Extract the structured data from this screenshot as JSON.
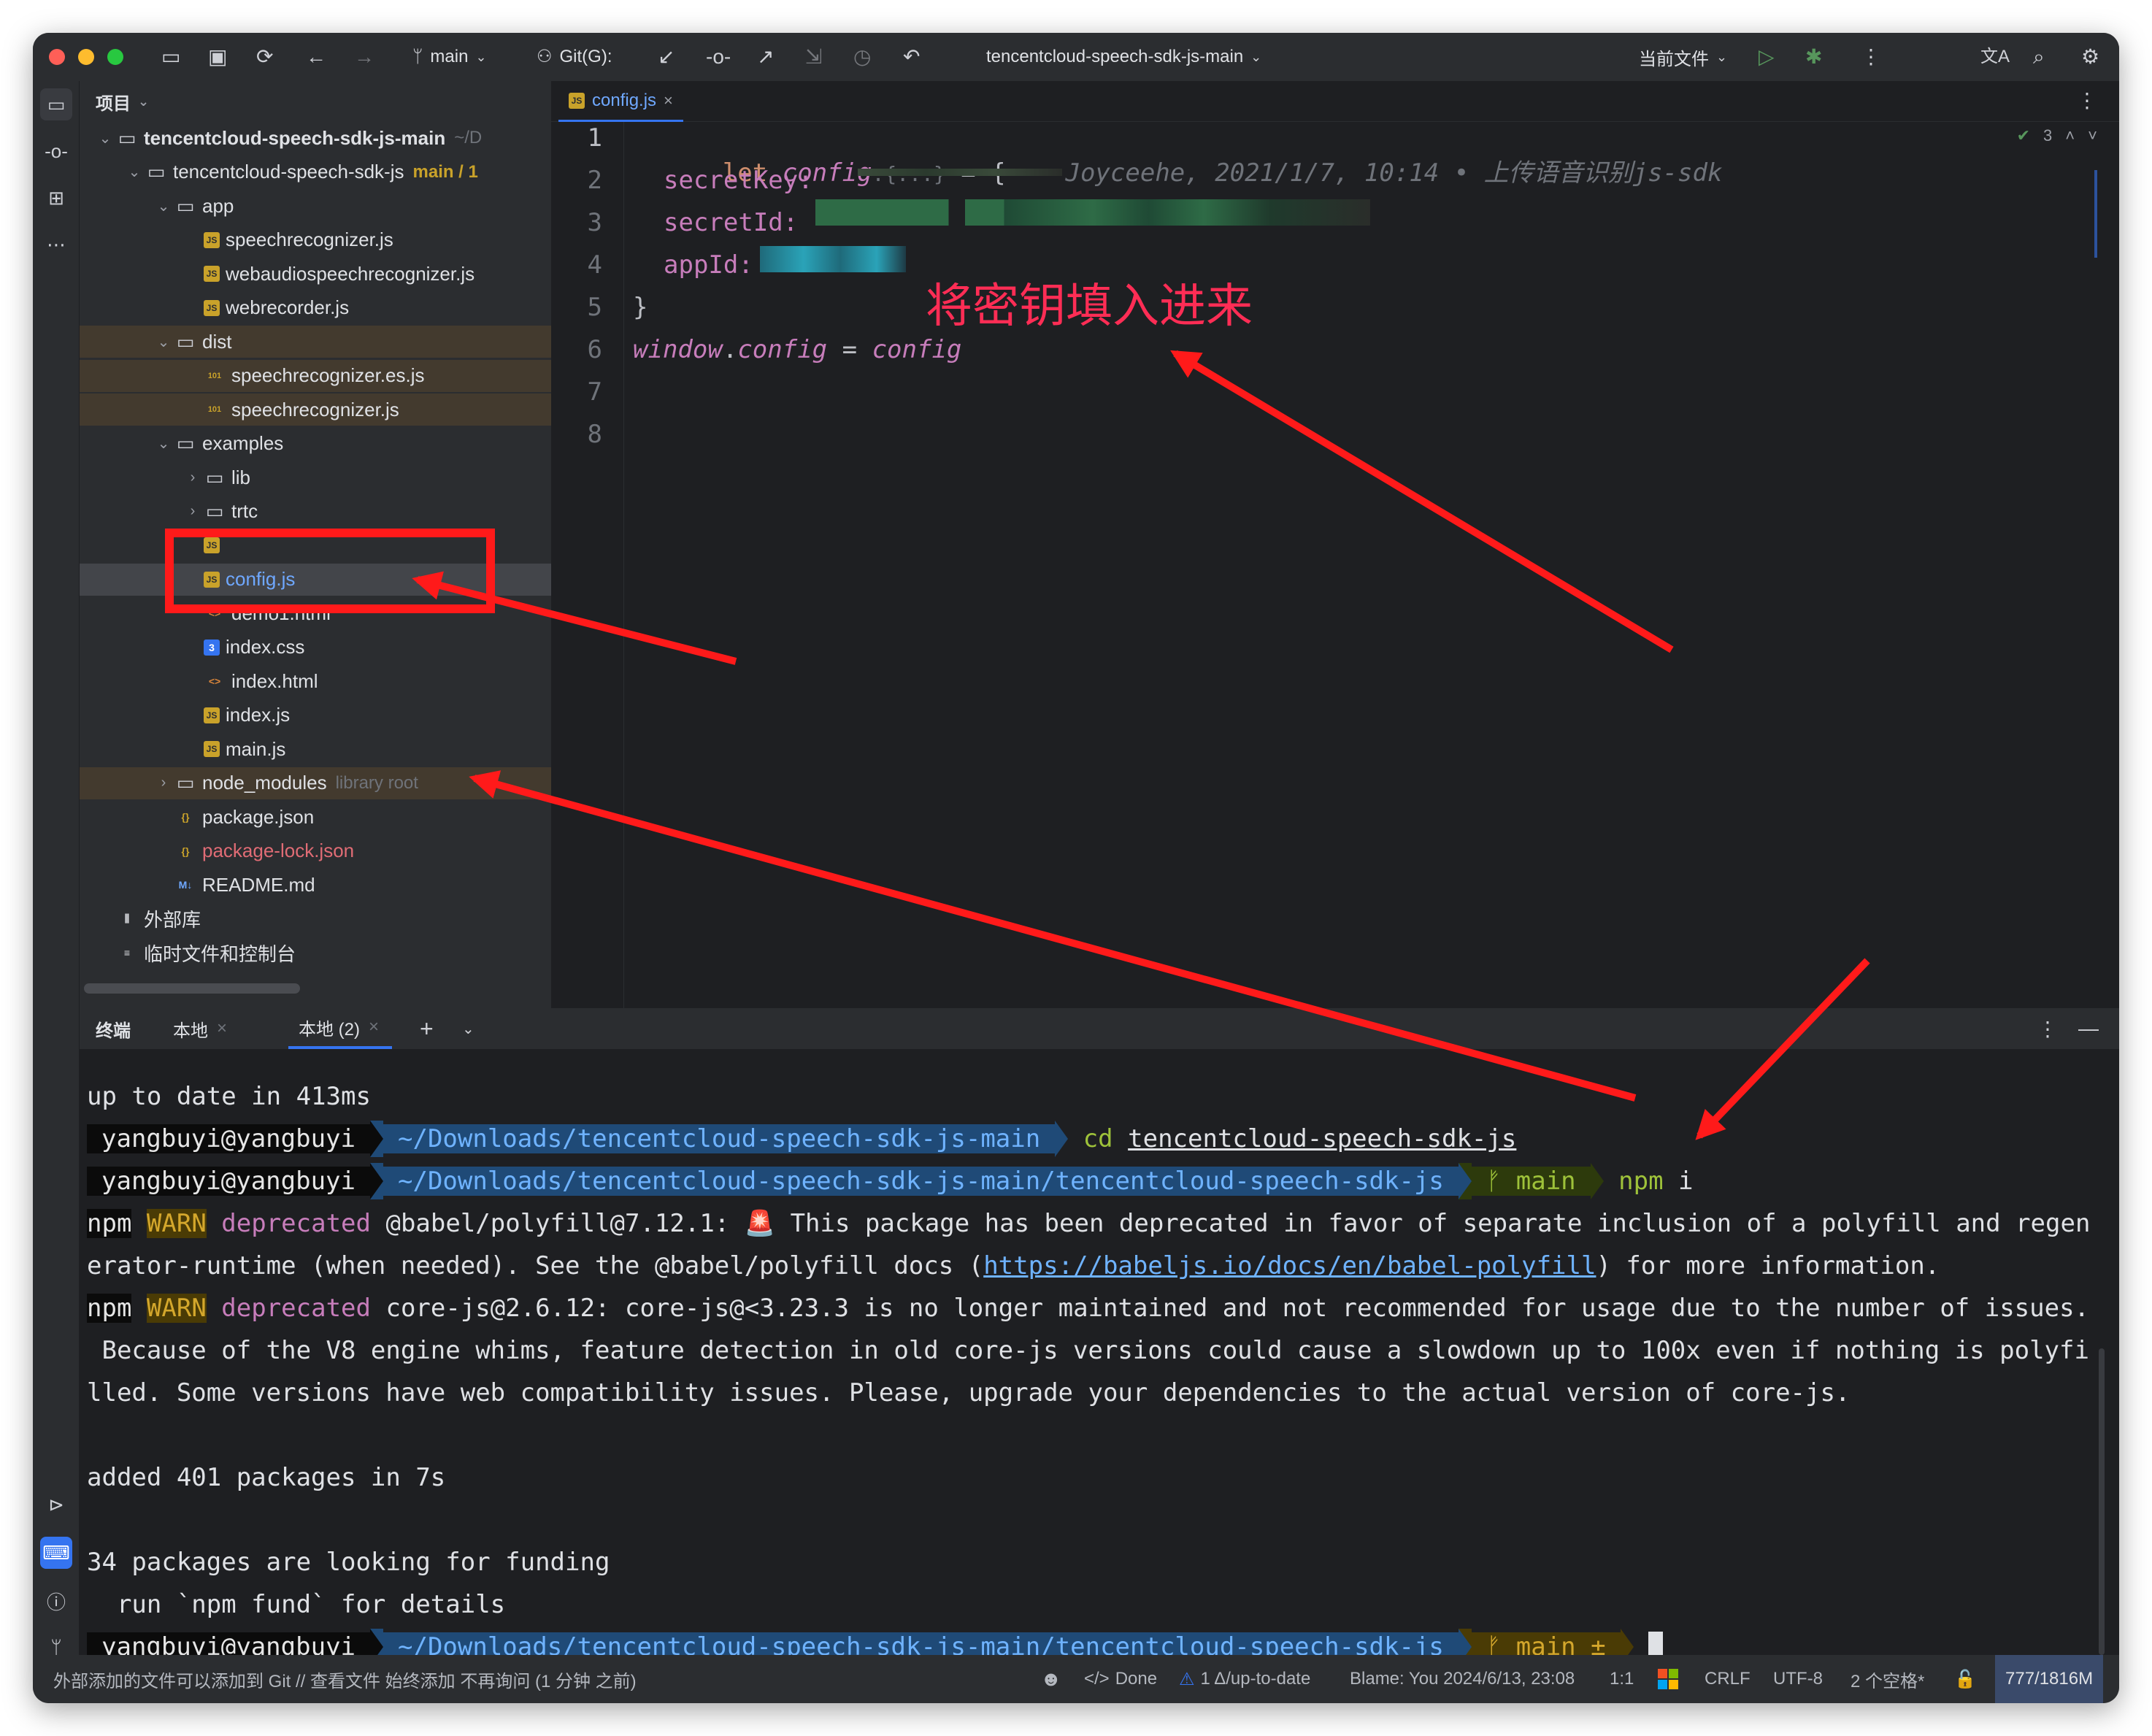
{
  "titlebar": {
    "branch": "main",
    "git_label": "Git(G):",
    "project_name": "tencentcloud-speech-sdk-js-main",
    "current_file": "当前文件"
  },
  "project": {
    "header": "项目",
    "tree": [
      {
        "label": "tencentcloud-speech-sdk-js-main",
        "suffix": "~/D",
        "indent": 0,
        "chev": "v",
        "icon": "folder",
        "bold": true
      },
      {
        "label": "tencentcloud-speech-sdk-js",
        "suffix": "main / 1",
        "indent": 1,
        "chev": "v",
        "icon": "folder"
      },
      {
        "label": "app",
        "indent": 2,
        "chev": "v",
        "icon": "folder"
      },
      {
        "label": "speechrecognizer.js",
        "indent": 3,
        "icon": "js"
      },
      {
        "label": "webaudiospeechrecognizer.js",
        "indent": 3,
        "icon": "js"
      },
      {
        "label": "webrecorder.js",
        "indent": 3,
        "icon": "js"
      },
      {
        "label": "dist",
        "indent": 2,
        "chev": "v",
        "icon": "folder",
        "hl": true
      },
      {
        "label": "speechrecognizer.es.js",
        "indent": 3,
        "icon": "bin",
        "hl": true
      },
      {
        "label": "speechrecognizer.js",
        "indent": 3,
        "icon": "bin",
        "hl": true
      },
      {
        "label": "examples",
        "indent": 2,
        "chev": "v",
        "icon": "folder"
      },
      {
        "label": "lib",
        "indent": 3,
        "chev": ">",
        "icon": "folder"
      },
      {
        "label": "trtc",
        "indent": 3,
        "chev": ">",
        "icon": "folder"
      },
      {
        "label": "",
        "indent": 3,
        "icon": "js"
      },
      {
        "label": "config.js",
        "indent": 3,
        "icon": "js",
        "selected": true
      },
      {
        "label": "demo1.html",
        "indent": 3,
        "icon": "html"
      },
      {
        "label": "index.css",
        "indent": 3,
        "icon": "css"
      },
      {
        "label": "index.html",
        "indent": 3,
        "icon": "html"
      },
      {
        "label": "index.js",
        "indent": 3,
        "icon": "js"
      },
      {
        "label": "main.js",
        "indent": 3,
        "icon": "js"
      },
      {
        "label": "node_modules",
        "suffix": "library root",
        "indent": 2,
        "chev": ">",
        "icon": "folder",
        "hl": true
      },
      {
        "label": "package.json",
        "indent": 2,
        "icon": "json"
      },
      {
        "label": "package-lock.json",
        "indent": 2,
        "icon": "json",
        "red": true
      },
      {
        "label": "README.md",
        "indent": 2,
        "icon": "md"
      },
      {
        "label": "外部库",
        "indent": 0,
        "icon": "lib"
      },
      {
        "label": "临时文件和控制台",
        "indent": 0,
        "icon": "scratch"
      }
    ]
  },
  "editor": {
    "tab": "config.js",
    "inspection_count": "3",
    "line_numbers": [
      "1",
      "2",
      "3",
      "4",
      "5",
      "6",
      "7",
      "8"
    ],
    "line1": {
      "kw": "let",
      "name": "config",
      "hint": ":{...}",
      "rest": " = {",
      "blame": "Joyceehe, 2021/1/7, 10:14 • 上传语音识别js-sdk"
    },
    "line2": "secretKey:",
    "line3": "secretId:",
    "line4": "appId:",
    "line5": "}",
    "line6": {
      "obj": "window",
      "prop": "config",
      "eq": " = ",
      "val": "config"
    }
  },
  "terminal": {
    "header": "终端",
    "tabs": [
      "本地",
      "本地 (2)"
    ],
    "lines": {
      "l1": "up to date in 413ms",
      "user": "yangbuyi@yangbuyi",
      "path1": "~/Downloads/tencentcloud-speech-sdk-js-main",
      "cmd1_kw": "cd",
      "cmd1_arg": "tencentcloud-speech-sdk-js",
      "path2": "~/Downloads/tencentcloud-speech-sdk-js-main/tencentcloud-speech-sdk-js",
      "branch": "main",
      "branch_dirty": "main ±",
      "cmd2_kw": "npm",
      "cmd2_arg": "i",
      "npm": "npm",
      "warn": "WARN",
      "deprecated": "deprecated",
      "w1a": "@babel/polyfill@7.12.1: ",
      "w1b": " This package has been deprecated in favor of separate inclusion of a polyfill and regen",
      "w1c": "erator-runtime (when needed). See the @babel/polyfill docs (",
      "w1link": "https://babeljs.io/docs/en/babel-polyfill",
      "w1d": ") for more information.",
      "w2a": "core-js@2.6.12: core-js@<3.23.3 is no longer maintained and not recommended for usage due to the number of issues.",
      "w2b": " Because of the V8 engine whims, feature detection in old core-js versions could cause a slowdown up to 100x even if nothing is polyfi",
      "w2c": "lled. Some versions have web compatibility issues. Please, upgrade your dependencies to the actual version of core-js.",
      "added": "added 401 packages in 7s",
      "fund1": "34 packages are looking for funding",
      "fund2": "  run `npm fund` for details"
    }
  },
  "status": {
    "message": "外部添加的文件可以添加到 Git // 查看文件   始终添加   不再询问 (1 分钟 之前)",
    "done": "Done",
    "vcs": "1 Δ/up-to-date",
    "blame": "Blame: You 2024/6/13, 23:08",
    "pos": "1:1",
    "eol": "CRLF",
    "enc": "UTF-8",
    "indent": "2 个空格*",
    "mem": "777/1816M"
  },
  "annotation": {
    "note": "将密钥填入进来"
  },
  "colors": {
    "accent": "#3574f0",
    "annotation_red": "#ff1a1a",
    "note_pink": "#ff2d55"
  }
}
